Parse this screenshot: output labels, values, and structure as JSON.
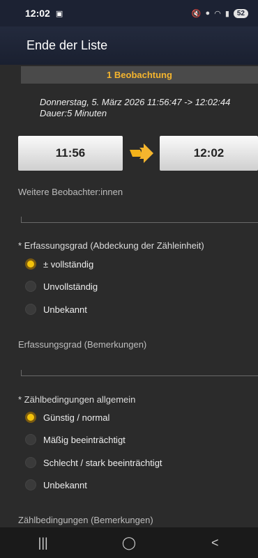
{
  "status_bar": {
    "time": "12:02",
    "battery": "52"
  },
  "appbar": {
    "title": "Ende der Liste"
  },
  "banner": {
    "count": "1 Beobachtung"
  },
  "time_info": {
    "line1": "Donnerstag, 5. März 2026 11:56:47 -> 12:02:44",
    "line2": "Dauer:5 Minuten"
  },
  "times": {
    "start": "11:56",
    "end": "12:02"
  },
  "fields": {
    "observers_label": "Weitere Beobachter:innen",
    "coverage_remarks_label": "Erfassungsgrad (Bemerkungen)",
    "conditions_remarks_label": "Zählbedingungen (Bemerkungen)"
  },
  "coverage": {
    "label": "* Erfassungsgrad (Abdeckung der Zähleinheit)",
    "options": [
      "± vollständig",
      "Unvollständig",
      "Unbekannt"
    ],
    "selected": 0
  },
  "conditions": {
    "label": "* Zählbedingungen allgemein",
    "options": [
      "Günstig / normal",
      "Mäßig beeinträchtigt",
      "Schlecht / stark beeinträchtigt",
      "Unbekannt"
    ],
    "selected": 0
  },
  "icons": {
    "arrow": "arrow-right-icon",
    "nav_recent": "recent-apps-icon",
    "nav_home": "home-icon",
    "nav_back": "back-icon"
  },
  "colors": {
    "accent": "#f3c20b",
    "banner_text": "#f5b52e",
    "appbar": "#1c2233"
  }
}
